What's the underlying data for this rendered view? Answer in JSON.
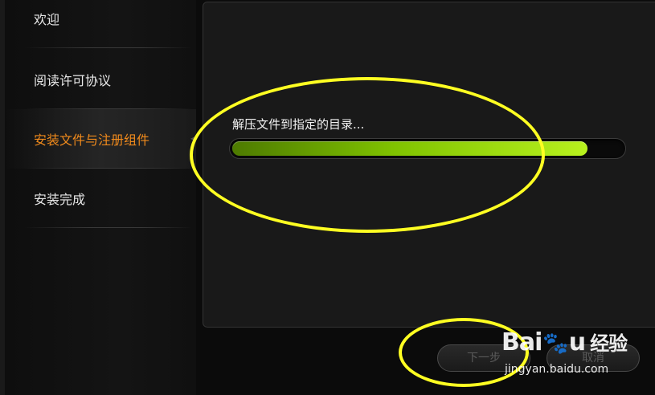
{
  "sidebar": {
    "steps": [
      {
        "label": "欢迎"
      },
      {
        "label": "阅读许可协议"
      },
      {
        "label": "安装文件与注册组件"
      },
      {
        "label": "安装完成"
      }
    ],
    "active_step": 2,
    "active_color": "#f08a1c"
  },
  "main": {
    "status_text": "解压文件到指定的目录...",
    "progress": 0.91,
    "progress_color": "#9be000"
  },
  "buttons": {
    "next_label": "下一步",
    "cancel_label": "取消"
  },
  "annotation": {
    "color": "#ffff22"
  },
  "watermark": {
    "brand_part1": "Bai",
    "brand_part2": "u",
    "brand_cn": "经验",
    "url": "jingyan.baidu.com",
    "paw_icon": "paw-icon"
  }
}
